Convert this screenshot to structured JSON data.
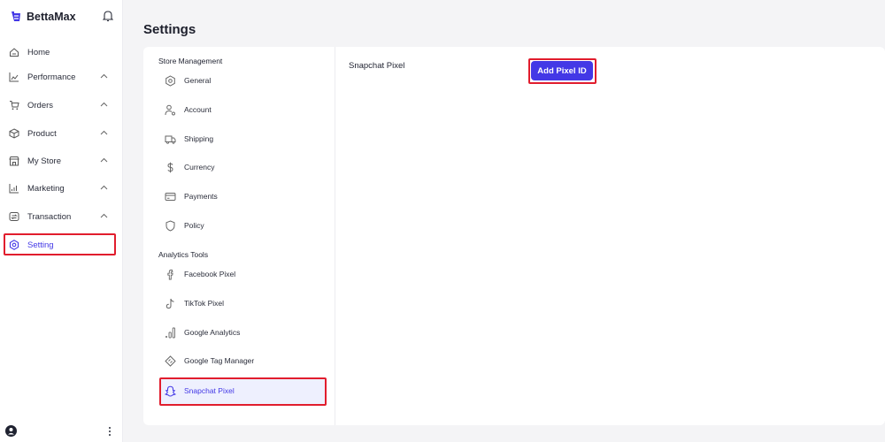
{
  "app": {
    "brand": "BettaMax",
    "accent": "#4338e6",
    "highlight_color": "#e11d2d"
  },
  "sidebar": {
    "items": [
      {
        "label": "Home",
        "icon": "home-icon",
        "expandable": false
      },
      {
        "label": "Performance",
        "icon": "chart-icon",
        "expandable": true
      },
      {
        "label": "Orders",
        "icon": "cart-icon",
        "expandable": true
      },
      {
        "label": "Product",
        "icon": "box-icon",
        "expandable": true
      },
      {
        "label": "My Store",
        "icon": "store-icon",
        "expandable": true
      },
      {
        "label": "Marketing",
        "icon": "marketing-icon",
        "expandable": true
      },
      {
        "label": "Transaction",
        "icon": "transaction-icon",
        "expandable": true
      },
      {
        "label": "Setting",
        "icon": "settings-icon",
        "expandable": false,
        "active": true
      }
    ]
  },
  "page": {
    "title": "Settings"
  },
  "settings_menu": {
    "store_section": "Store Management",
    "store_items": [
      {
        "label": "General",
        "icon": "general-icon"
      },
      {
        "label": "Account",
        "icon": "account-icon"
      },
      {
        "label": "Shipping",
        "icon": "truck-icon"
      },
      {
        "label": "Currency",
        "icon": "dollar-icon"
      },
      {
        "label": "Payments",
        "icon": "card-icon"
      },
      {
        "label": "Policy",
        "icon": "shield-icon"
      }
    ],
    "analytics_section": "Analytics Tools",
    "analytics_items": [
      {
        "label": "Facebook Pixel",
        "icon": "facebook-icon"
      },
      {
        "label": "TikTok Pixel",
        "icon": "tiktok-icon"
      },
      {
        "label": "Google Analytics",
        "icon": "analytics-icon"
      },
      {
        "label": "Google Tag Manager",
        "icon": "tag-manager-icon"
      },
      {
        "label": "Snapchat Pixel",
        "icon": "snapchat-icon",
        "active": true
      }
    ]
  },
  "content": {
    "label": "Snapchat Pixel",
    "add_button": "Add Pixel ID"
  }
}
